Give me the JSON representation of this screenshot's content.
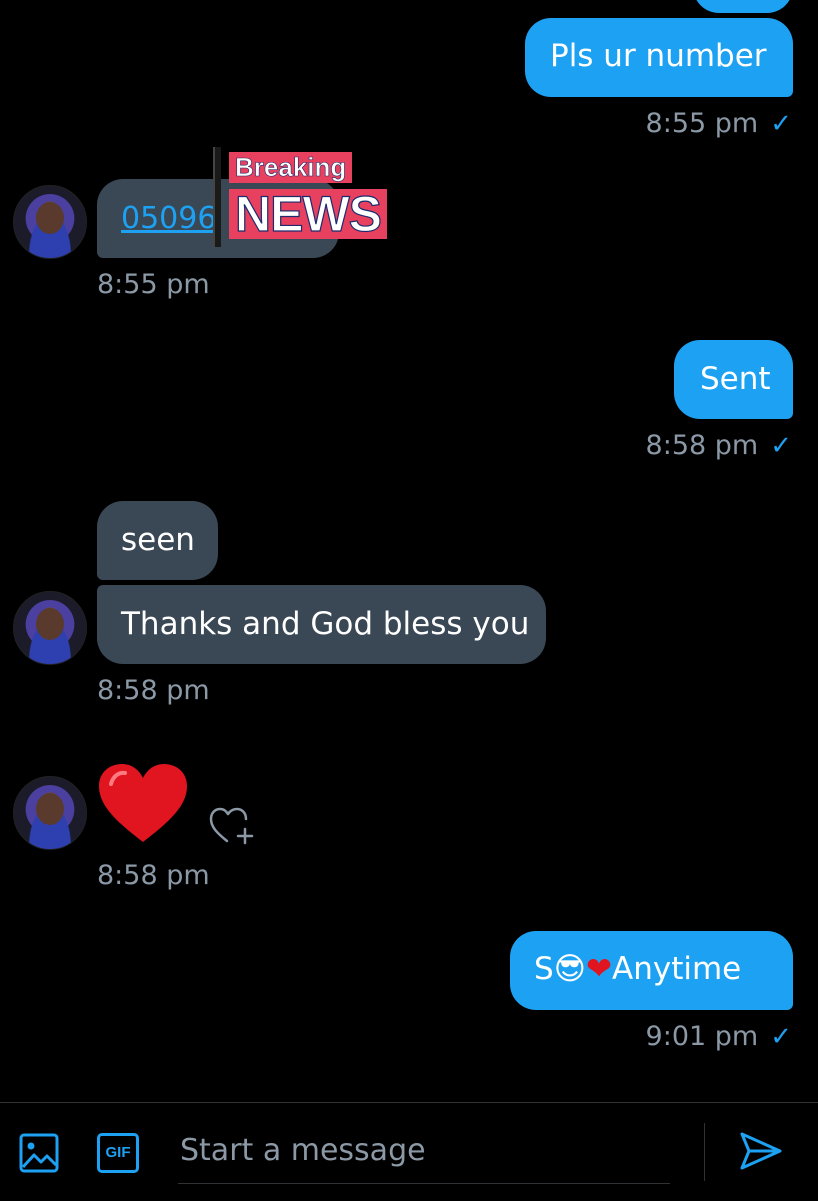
{
  "messages": {
    "m1": {
      "text": "Pls ur number",
      "time": "8:55 pm",
      "check": "✓"
    },
    "m2": {
      "text": "05096",
      "time": "8:55 pm"
    },
    "m3": {
      "text": "Sent",
      "time": "8:58 pm",
      "check": "✓"
    },
    "m4a": {
      "text": "seen"
    },
    "m4b": {
      "text": "Thanks and God bless you",
      "time": "8:58 pm"
    },
    "m5": {
      "time": "8:58 pm"
    },
    "m6": {
      "text_start": "S",
      "emoji_a": "😎",
      "emoji_b": "❤",
      "text_end": "Anytime",
      "time": "9:01 pm",
      "check": "✓"
    }
  },
  "overlay": {
    "line1": "Breaking",
    "line2": "NEWS"
  },
  "composer": {
    "placeholder": "Start a message",
    "gif_label": "GIF"
  },
  "colors": {
    "accent": "#1da1f2",
    "incoming_bubble": "#3a4855",
    "timestamp": "#8b98a5",
    "heart": "#e0151f"
  },
  "icons": [
    "image-icon",
    "gif-icon",
    "send-icon",
    "add-reaction-icon",
    "heart-emoji-icon"
  ]
}
